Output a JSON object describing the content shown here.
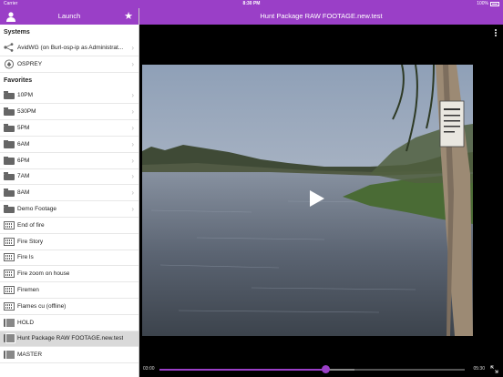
{
  "status": {
    "carrier": "Carrier",
    "time": "8:30 PM",
    "battery": "100%"
  },
  "sidebar_header": {
    "title": "Launch",
    "user_icon": "user-icon",
    "favorites_icon": "star-icon"
  },
  "player_header": {
    "title": "Hunt Package RAW FOOTAGE.new.test",
    "more_icon": "more-vertical-icon"
  },
  "systems": {
    "heading": "Systems",
    "items": [
      {
        "label": "AvidWG (on Burl-osp-ip as Administrat...",
        "icon": "network-icon"
      },
      {
        "label": "OSPREY",
        "icon": "osprey-logo-icon"
      }
    ]
  },
  "favorites": {
    "heading": "Favorites",
    "items": [
      {
        "label": "10PM",
        "icon": "folder-icon"
      },
      {
        "label": "530PM",
        "icon": "folder-icon"
      },
      {
        "label": "5PM",
        "icon": "folder-icon"
      },
      {
        "label": "6AM",
        "icon": "folder-icon"
      },
      {
        "label": "6PM",
        "icon": "folder-icon"
      },
      {
        "label": "7AM",
        "icon": "folder-icon"
      },
      {
        "label": "8AM",
        "icon": "folder-icon"
      },
      {
        "label": "Demo Footage",
        "icon": "folder-icon"
      },
      {
        "label": "End of fire",
        "icon": "clip-icon"
      },
      {
        "label": "Fire Story",
        "icon": "clip-icon"
      },
      {
        "label": "Fire ls",
        "icon": "clip-icon"
      },
      {
        "label": "Fire zoom on house",
        "icon": "clip-icon"
      },
      {
        "label": "Firemen",
        "icon": "clip-icon"
      },
      {
        "label": "Flames cu (offline)",
        "icon": "clip-icon"
      },
      {
        "label": "HOLD",
        "icon": "sequence-icon"
      },
      {
        "label": "Hunt Package RAW FOOTAGE.new.test",
        "icon": "sequence-icon",
        "selected": true
      },
      {
        "label": "MASTER",
        "icon": "sequence-icon"
      }
    ]
  },
  "playback": {
    "current_time": "03:00",
    "duration": "05:30",
    "progress": 0.545,
    "buffered": 0.64,
    "accent": "#9a3fc7",
    "play_icon": "play-icon",
    "fullscreen_icon": "expand-icon"
  }
}
